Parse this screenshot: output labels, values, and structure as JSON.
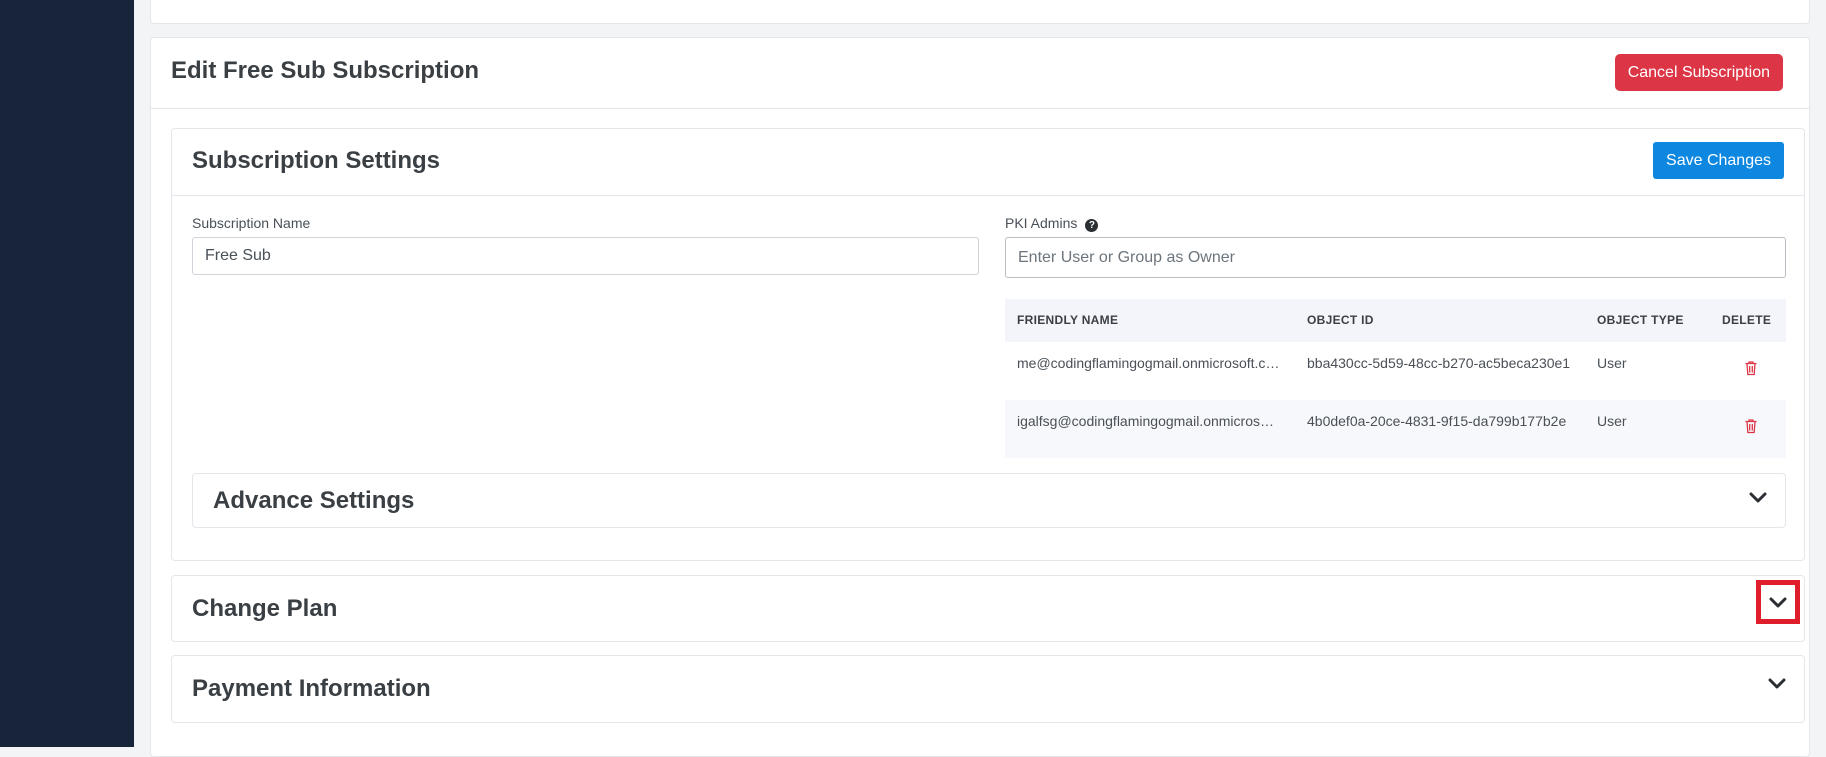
{
  "page": {
    "title": "Edit Free Sub Subscription",
    "cancel_label": "Cancel Subscription"
  },
  "settings": {
    "title": "Subscription Settings",
    "save_label": "Save Changes",
    "name_label": "Subscription Name",
    "name_value": "Free Sub",
    "admins_label": "PKI Admins",
    "admins_placeholder": "Enter User or Group as Owner",
    "help_glyph": "?"
  },
  "admins_table": {
    "headers": [
      "FRIENDLY NAME",
      "OBJECT ID",
      "OBJECT TYPE",
      "DELETE"
    ],
    "rows": [
      {
        "friendly_name": "me@codingflamingogmail.onmicrosoft.com",
        "object_id": "bba430cc-5d59-48cc-b270-ac5beca230e1",
        "object_type": "User"
      },
      {
        "friendly_name": "igalfsg@codingflamingogmail.onmicrosoft.com",
        "object_id": "4b0def0a-20ce-4831-9f15-da799b177b2e",
        "object_type": "User"
      }
    ]
  },
  "sections": {
    "advance": "Advance Settings",
    "change_plan": "Change Plan",
    "payment": "Payment Information"
  },
  "colors": {
    "sidebar": "#17243a",
    "danger": "#dc3545",
    "primary": "#0d87e0",
    "highlight": "#e01e2b"
  },
  "icons": {
    "delete": "trash-icon",
    "expand": "chevron-down-icon",
    "help": "question-circle-icon"
  }
}
